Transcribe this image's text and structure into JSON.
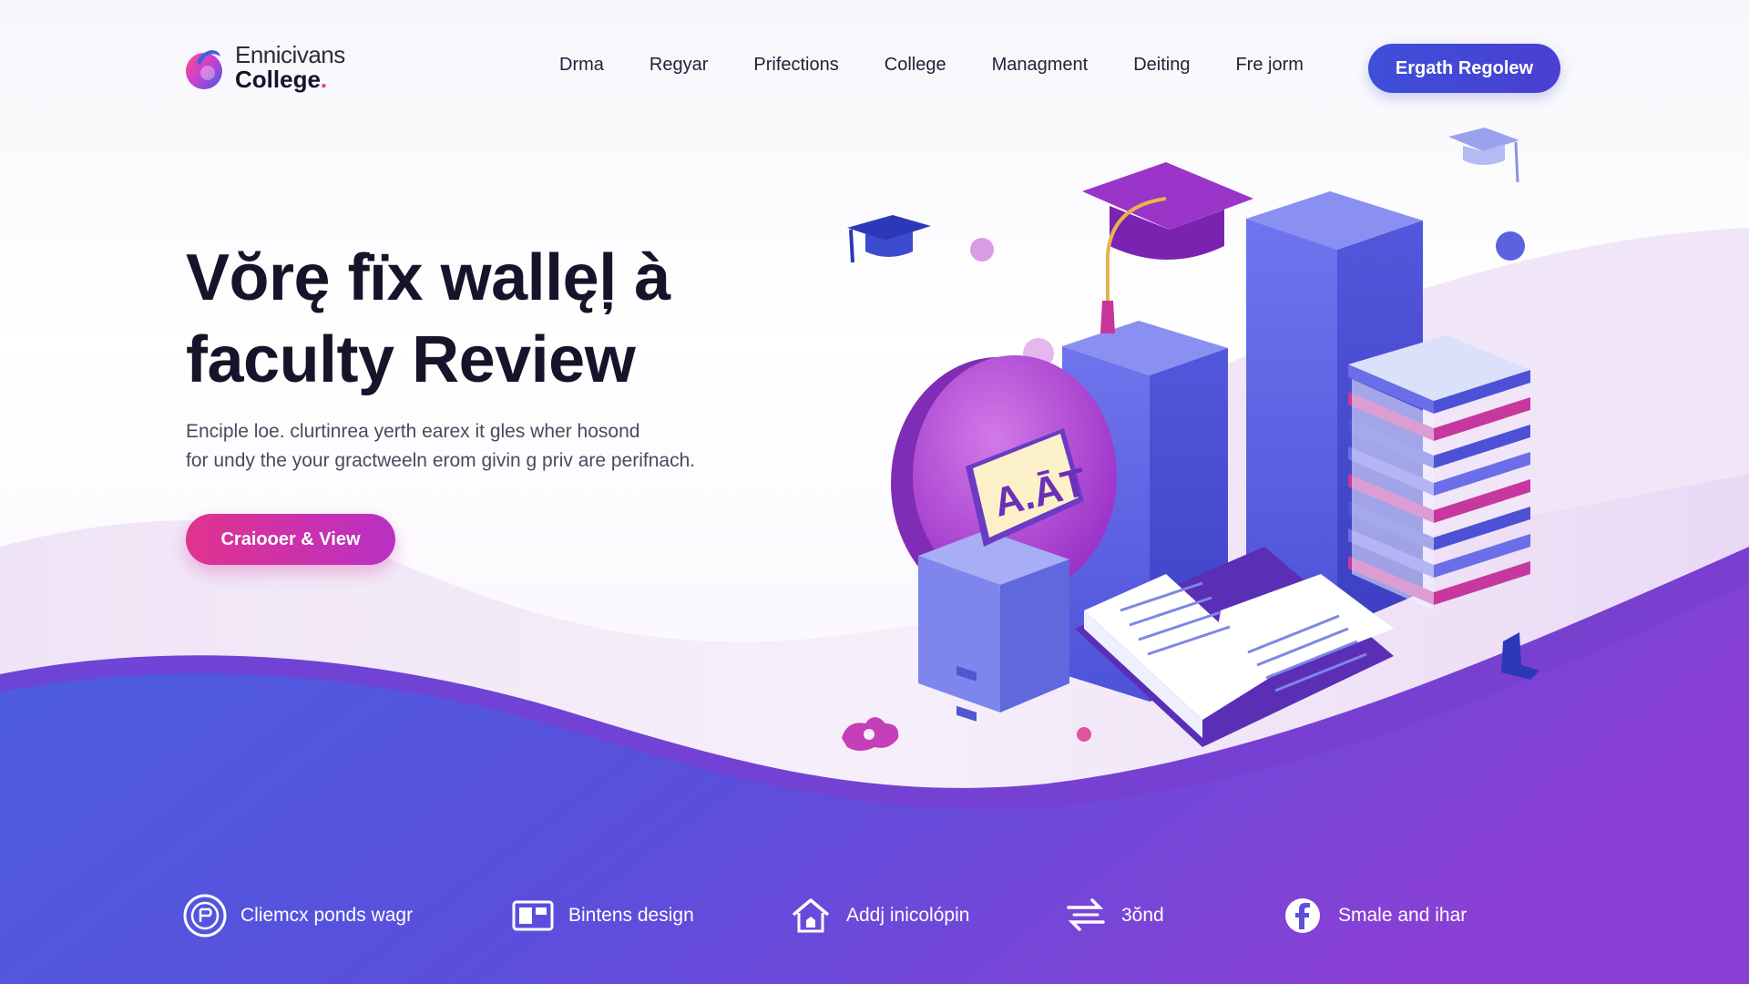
{
  "brand": {
    "name_line1": "Ennicivans",
    "name_line2": "College",
    "accent": "#e23aa4"
  },
  "nav": {
    "items": [
      "Drma",
      "Regyar",
      "Prifections",
      "College",
      "Managment",
      "Deiting",
      "Fre jorm"
    ],
    "cta_label": "Ergath Regolew"
  },
  "hero": {
    "title_line1": "Vŏrę fïx wallęļ à",
    "title_line2": "faculty Review",
    "subtitle_line1": "Enciple loe. clurtinrea yerth earex it gles wher hosond",
    "subtitle_line2": "for undy the your gractweeln erom givin g priv are perifnach.",
    "cta_label": "Craiooer & View"
  },
  "illustration": {
    "plaque_text": "A.ĀT",
    "icons": [
      "graduation-cap-icon",
      "bar-chart-icon",
      "book-stack-icon",
      "open-book-icon",
      "cabinet-icon",
      "puzzle-piece-icon"
    ]
  },
  "features": [
    {
      "label": "Cliemcx ponds wagr",
      "icon": "badge-icon"
    },
    {
      "label": "Bintens design",
      "icon": "layout-icon"
    },
    {
      "label": "Addj inicolópin",
      "icon": "home-shield-icon"
    },
    {
      "label": "3ŏnd",
      "icon": "exchange-icon"
    },
    {
      "label": "Smale and ihar",
      "icon": "facebook-icon"
    }
  ],
  "colors": {
    "primary": "#3d4fd8",
    "purple": "#7c3fd6",
    "magenta": "#e0338f",
    "text": "#16142a"
  }
}
